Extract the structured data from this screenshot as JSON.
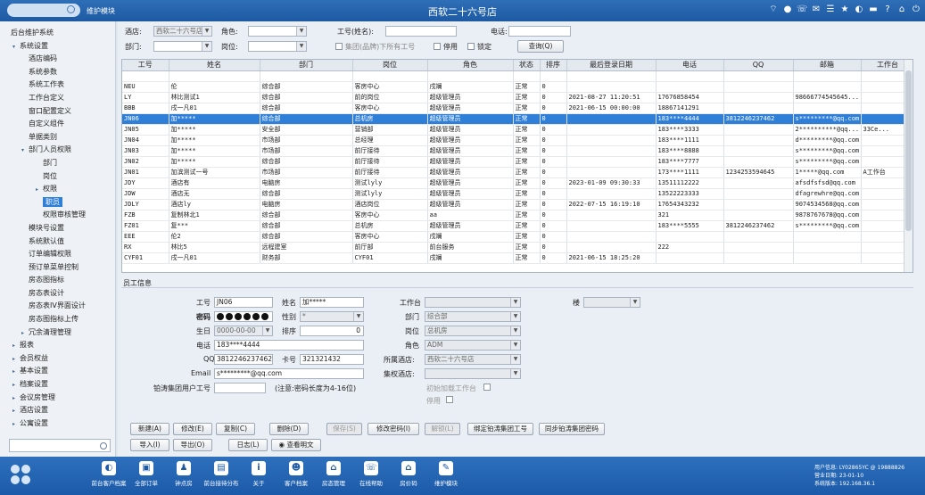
{
  "titlebar": {
    "module": "维护模块",
    "title": "西软二十六号店"
  },
  "sidebar": {
    "items": [
      {
        "label": "后台维护系统",
        "level": 0,
        "arrow": ""
      },
      {
        "label": "系统设置",
        "level": 1,
        "arrow": "▾"
      },
      {
        "label": "酒店编码",
        "level": 2,
        "arrow": ""
      },
      {
        "label": "系统参数",
        "level": 2,
        "arrow": ""
      },
      {
        "label": "系统工作表",
        "level": 2,
        "arrow": ""
      },
      {
        "label": "工作台定义",
        "level": 2,
        "arrow": ""
      },
      {
        "label": "窗口配置定义",
        "level": 2,
        "arrow": ""
      },
      {
        "label": "自定义组件",
        "level": 2,
        "arrow": ""
      },
      {
        "label": "单据类别",
        "level": 2,
        "arrow": ""
      },
      {
        "label": "部门人员权限",
        "level": 2,
        "arrow": "▾"
      },
      {
        "label": "部门",
        "level": 3,
        "arrow": ""
      },
      {
        "label": "岗位",
        "level": 3,
        "arrow": ""
      },
      {
        "label": "权限",
        "level": 3,
        "arrow": "▸"
      },
      {
        "label": "职员",
        "level": 3,
        "arrow": "",
        "selected": true
      },
      {
        "label": "权限审核管理",
        "level": 3,
        "arrow": ""
      },
      {
        "label": "模块号设置",
        "level": 2,
        "arrow": ""
      },
      {
        "label": "系统默认值",
        "level": 2,
        "arrow": ""
      },
      {
        "label": "订单编辑权限",
        "level": 2,
        "arrow": ""
      },
      {
        "label": "预订单菜单控制",
        "level": 2,
        "arrow": ""
      },
      {
        "label": "房态图指标",
        "level": 2,
        "arrow": ""
      },
      {
        "label": "房态表设计",
        "level": 2,
        "arrow": ""
      },
      {
        "label": "房态表IV界面设计",
        "level": 2,
        "arrow": ""
      },
      {
        "label": "房态图指标上传",
        "level": 2,
        "arrow": ""
      },
      {
        "label": "冗余清理管理",
        "level": 2,
        "arrow": "▸"
      },
      {
        "label": "报表",
        "level": 1,
        "arrow": "▸"
      },
      {
        "label": "会员权益",
        "level": 1,
        "arrow": "▸"
      },
      {
        "label": "基本设置",
        "level": 1,
        "arrow": "▸"
      },
      {
        "label": "档案设置",
        "level": 1,
        "arrow": "▸"
      },
      {
        "label": "会议房管理",
        "level": 1,
        "arrow": "▸"
      },
      {
        "label": "酒店设置",
        "level": 1,
        "arrow": "▸"
      },
      {
        "label": "公寓设置",
        "level": 1,
        "arrow": "▸"
      },
      {
        "label": "数据设置",
        "level": 1,
        "arrow": "▸"
      }
    ],
    "search_placeholder": ""
  },
  "filter": {
    "hotel_label": "酒店:",
    "hotel_value": "西软二十六号店",
    "role_label": "角色:",
    "role_value": "",
    "empno_label": "工号(姓名):",
    "empno_value": "",
    "phone_label": "电话:",
    "phone_value": "",
    "dept_label": "部门:",
    "dept_value": "",
    "post_label": "岗位:",
    "post_value": "",
    "group_check_label": "集团(品牌)下所有工号",
    "disabled_check_label": "停用",
    "locked_check_label": "锁定",
    "query_button": "查询(Q)"
  },
  "grid": {
    "columns": [
      "工号",
      "姓名",
      "部门",
      "岗位",
      "角色",
      "状态",
      "排序",
      "最后登录日期",
      "电话",
      "QQ",
      "邮箱",
      "工作台"
    ],
    "rows": [
      [
        "",
        "",
        "",
        "",
        "",
        "",
        "",
        "",
        "",
        "",
        "",
        ""
      ],
      [
        "NEU",
        "伦",
        "综合部",
        "客房中心",
        "戌斓",
        "正常",
        "0",
        "",
        "",
        "",
        "",
        ""
      ],
      [
        "LY",
        "林比测试1",
        "综合部",
        "前的岗位",
        "超级管理员",
        "正常",
        "0",
        "2021-08-27 11:20:51",
        "17676858454",
        "",
        "9866677454564​5...",
        ""
      ],
      [
        "BBB",
        "戌一凡01",
        "综合部",
        "客房中心",
        "超级管理员",
        "正常",
        "0",
        "2021-06-15 00:00:00",
        "18867141291",
        "",
        "",
        ""
      ],
      [
        "JN06",
        "加*****",
        "综合部",
        "总机房",
        "超级管理员",
        "正常",
        "0",
        "",
        "183****4444",
        "3812246237462",
        "s*********@qq.com",
        ""
      ],
      [
        "JN05",
        "加*****",
        "安全部",
        "营销部",
        "超级管理员",
        "正常",
        "0",
        "",
        "183****3333",
        "",
        "2**********@qq...",
        "33Ce..."
      ],
      [
        "JN04",
        "加*****",
        "市场部",
        "总经理",
        "超级管理员",
        "正常",
        "0",
        "",
        "183****1111",
        "",
        "d*********@qq.com",
        ""
      ],
      [
        "JN03",
        "加*****",
        "市场部",
        "前厅接待",
        "超级管理员",
        "正常",
        "0",
        "",
        "183****8888",
        "",
        "s*********@qq.com",
        ""
      ],
      [
        "JN02",
        "加*****",
        "综合部",
        "前厅接待",
        "超级管理员",
        "正常",
        "0",
        "",
        "183****7777",
        "",
        "s*********@qq.com",
        ""
      ],
      [
        "JN01",
        "加滨测试一号",
        "市场部",
        "前厅接待",
        "超级管理员",
        "正常",
        "0",
        "",
        "173****1111",
        "1234253594645",
        "1*****@qq.com",
        "A工作台"
      ],
      [
        "JDY",
        "酒店有",
        "电脑房",
        "测试lyly",
        "超级管理员",
        "正常",
        "0",
        "2023-01-09 09:30:33",
        "13511112222",
        "",
        "afsdfsfsd@qq.com",
        ""
      ],
      [
        "JDW",
        "酒店无",
        "综合部",
        "测试lyly",
        "超级管理员",
        "正常",
        "0",
        "",
        "13522223333",
        "",
        "dfagrewhre@qq.com",
        ""
      ],
      [
        "JDLY",
        "酒店ly",
        "电脑房",
        "酒店岗位",
        "超级管理员",
        "正常",
        "0",
        "2022-07-15 16:19:10",
        "17654343232",
        "",
        "9074534568@qq.com",
        ""
      ],
      [
        "FZB",
        "复制林北1",
        "综合部",
        "客房中心",
        "aa",
        "正常",
        "0",
        "",
        "321",
        "",
        "9878767678@qq.com",
        ""
      ],
      [
        "FZ01",
        "复***",
        "综合部",
        "总机房",
        "超级管理员",
        "正常",
        "0",
        "",
        "183****5555",
        "3812246237462",
        "s*********@qq.com",
        ""
      ],
      [
        "EEE",
        "伦2",
        "综合部",
        "客房中心",
        "戌斓",
        "正常",
        "0",
        "",
        "",
        "",
        "",
        ""
      ],
      [
        "RX",
        "林比5",
        "远程建室",
        "前厅部",
        "前台服务",
        "正常",
        "0",
        "",
        "222",
        "",
        "",
        ""
      ],
      [
        "CYF01",
        "戌一凡01",
        "财务部",
        "CYF01",
        "戌斓",
        "正常",
        "0",
        "2021-06-15 18:25:20",
        "",
        "",
        "",
        ""
      ]
    ],
    "selected_row": 4
  },
  "detail": {
    "section_title": "员工信息",
    "empno_label": "工号",
    "empno_value": "JN06",
    "name_label": "姓名",
    "name_value": "加*****",
    "workbench_label": "工作台",
    "workbench_value": "",
    "floor_label": "楼",
    "floor_value": "",
    "password_label": "密码",
    "gender_label": "性别",
    "gender_value": "*",
    "dept_label": "部门",
    "dept_value": "综合部",
    "birthday_label": "生日",
    "birthday_value": "0000-00-00",
    "sort_label": "排序",
    "sort_value": "0",
    "post_label": "岗位",
    "post_value": "总机房",
    "phone_label": "电话",
    "phone_value": "183****4444",
    "role_label": "角色",
    "role_value": "ADM",
    "qq_label": "QQ",
    "qq_value": "3812246237462",
    "card_label": "卡号",
    "card_value": "321321432",
    "hotel_label": "所属酒店:",
    "hotel_value": "西软二十六号店",
    "email_label": "Email",
    "email_value": "s*********@qq.com",
    "group_hotel_label": "集权酒店:",
    "group_hotel_value": "",
    "group_user_label": "铂涛集团用户工号",
    "group_user_value": "",
    "pwd_note": "(注意:密码长度为4-16位)",
    "init_workbench_label": "初始加载工作台",
    "disabled_label": "停用"
  },
  "buttons": {
    "add": "新建(A)",
    "edit": "修改(E)",
    "copy": "复制(C)",
    "delete": "删除(D)",
    "save": "保存(S)",
    "change_pwd": "修改密码(I)",
    "unlock": "解锁(L)",
    "bind_group": "绑定铂涛集团工号",
    "sync_group": "同步铂涛集团密码",
    "import": "导入(I)",
    "export": "导出(O)",
    "log": "日志(L)",
    "view_detail": "查看明文"
  },
  "taskbar": {
    "items": [
      {
        "label": "前台客户档案",
        "icon": "user-card-icon"
      },
      {
        "label": "全部订单",
        "icon": "orders-icon"
      },
      {
        "label": "钟点房",
        "icon": "people-icon"
      },
      {
        "label": "前台接待分布",
        "icon": "image-icon"
      },
      {
        "label": "关于",
        "icon": "info-icon"
      },
      {
        "label": "客户档案",
        "icon": "person-icon"
      },
      {
        "label": "房态管理",
        "icon": "house-icon"
      },
      {
        "label": "在线帮助",
        "icon": "phone-icon"
      },
      {
        "label": "房价码",
        "icon": "home-icon"
      },
      {
        "label": "维护模块",
        "icon": "tools-icon"
      }
    ],
    "info_lines": [
      "用户信息:  LY02865YC @ 19888826",
      "营业日期:  23-01-10",
      "系统版本:  192.168.36.1"
    ]
  },
  "colors": {
    "titlebar": "#1d5aa3",
    "selection": "#2f7fd8",
    "taskbar": "#1b5aa8"
  }
}
